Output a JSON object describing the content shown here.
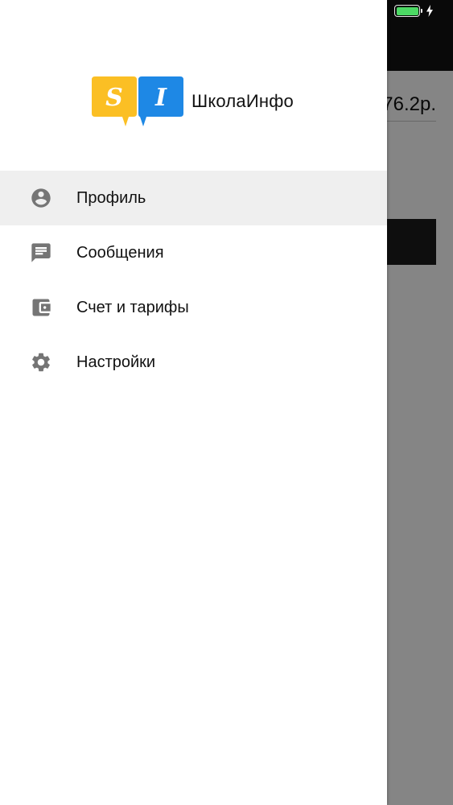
{
  "status_bar": {
    "battery_color": "#4cd964",
    "battery_icon": "battery-icon",
    "charging_icon": "bolt-icon"
  },
  "background": {
    "amount": "76.2р."
  },
  "drawer": {
    "logo": {
      "badge_left": "S",
      "badge_right": "I",
      "badge_left_color": "#fbbf24",
      "badge_right_color": "#1e88e5",
      "app_name": "ШколаИнфо"
    },
    "menu": [
      {
        "label": "Профиль",
        "icon": "account-circle-icon",
        "active": true
      },
      {
        "label": "Сообщения",
        "icon": "message-icon",
        "active": false
      },
      {
        "label": "Счет и тарифы",
        "icon": "wallet-icon",
        "active": false
      },
      {
        "label": "Настройки",
        "icon": "gear-icon",
        "active": false
      }
    ]
  }
}
